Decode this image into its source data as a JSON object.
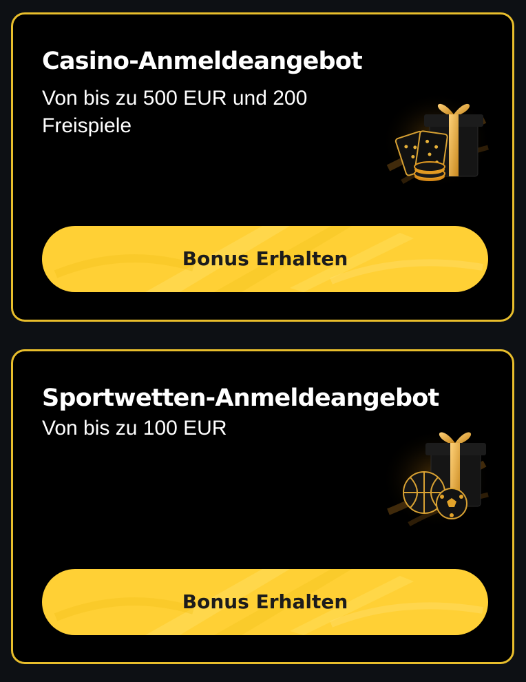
{
  "offers": [
    {
      "title": "Casino-Anmeldeangebot",
      "description": "Von bis zu 500 EUR und 200 Freispiele",
      "button_label": "Bonus Erhalten",
      "illustration_icon": "gift-box-with-playing-cards-and-casino-chips-icon"
    },
    {
      "title": "Sportwetten-Anmeldeangebot",
      "description": "Von bis zu 100 EUR",
      "button_label": "Bonus Erhalten",
      "illustration_icon": "gift-box-with-basketball-and-soccer-ball-icon"
    }
  ],
  "colors": {
    "page_background": "#0d1014",
    "card_background": "#000000",
    "card_border": "#e8be2c",
    "button_background": "#ffd035",
    "button_text": "#1c1c1c",
    "title_text": "#ffffff"
  }
}
